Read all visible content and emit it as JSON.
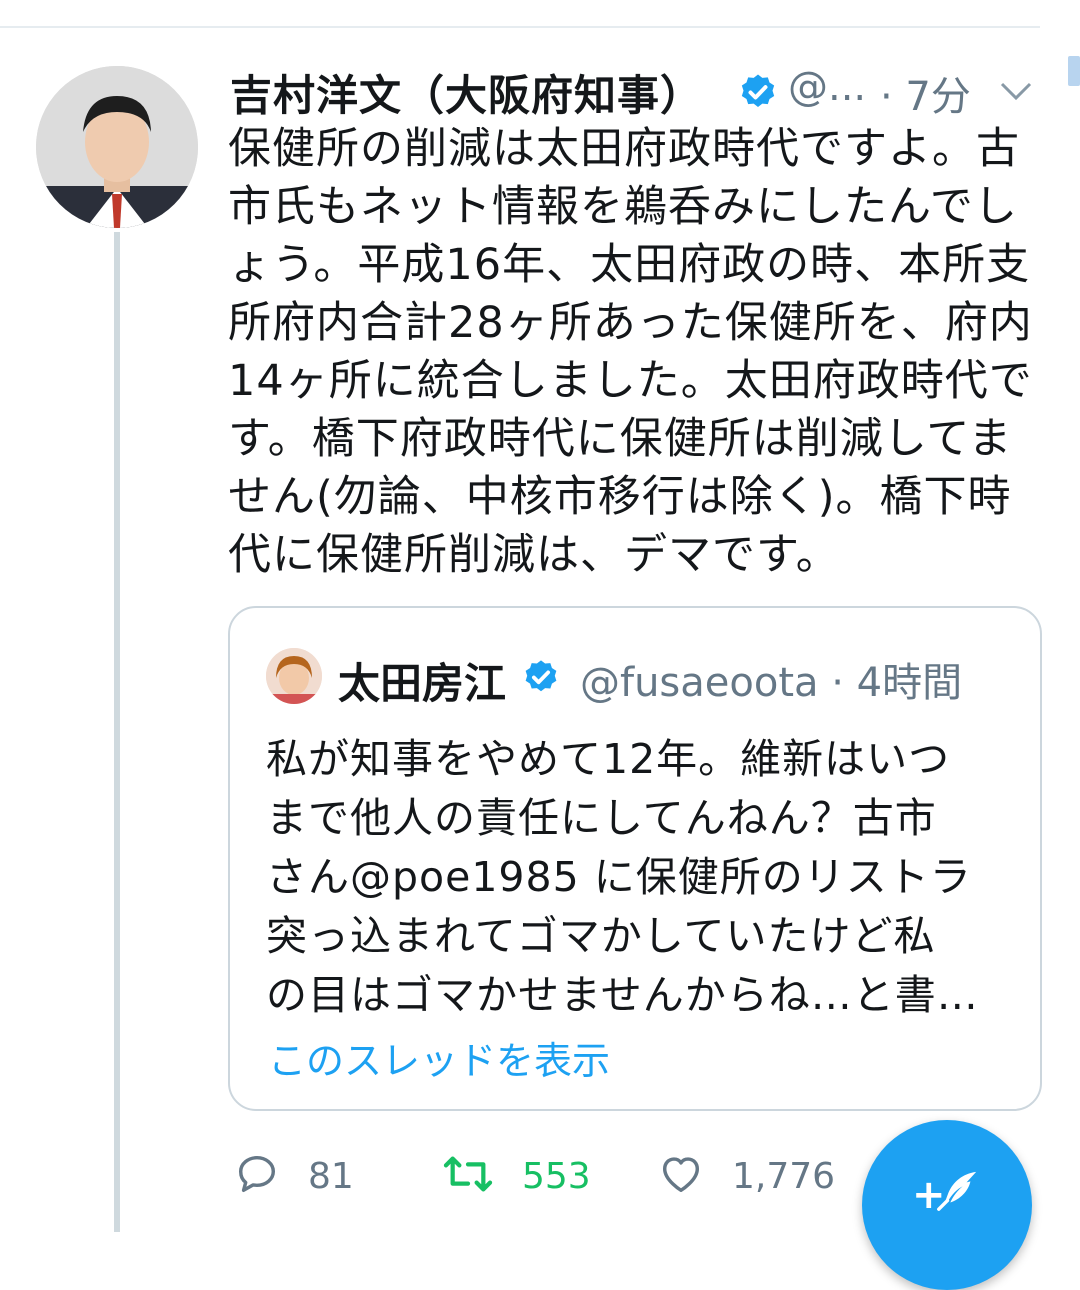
{
  "tweet": {
    "author_name": "吉村洋文（大阪府知事）",
    "handle": "@...",
    "time": "· 7分",
    "verified": true,
    "text_lines": [
      "保健所の削減は太田府政時代ですよ。古",
      "市氏もネット情報を鵜呑みにしたんでし",
      "ょう。平成16年、太田府政の時、本所支",
      "所府内合計28ヶ所あった保健所を、府内",
      "14ヶ所に統合しました。太田府政時代で",
      "す。橋下府政時代に保健所は削減してま",
      "せん(勿論、中核市移行は除く)。橋下時",
      "代に保健所削減は、デマです。"
    ]
  },
  "quoted": {
    "author_name": "太田房江",
    "handle_time": "@fusaeoota · 4時間",
    "verified": true,
    "text_lines": [
      "私が知事をやめて12年。維新はいつ",
      "まで他人の責任にしてんねん？古市",
      "さん@poe1985 に保健所のリストラ",
      "突っ込まれてゴマかしていたけど私",
      "の目はゴマかせませんからね…と書…"
    ],
    "show_thread_label": "このスレッドを表示"
  },
  "actions": {
    "reply_count": "81",
    "retweet_count": "553",
    "like_count": "1,776"
  },
  "colors": {
    "accent": "#1da1f2",
    "retweet_green": "#17bf63",
    "muted": "#657786",
    "border": "#ccd6dd"
  },
  "icons": [
    "verified-badge-icon",
    "chevron-down-icon",
    "reply-icon",
    "retweet-icon",
    "like-icon",
    "compose-icon"
  ]
}
